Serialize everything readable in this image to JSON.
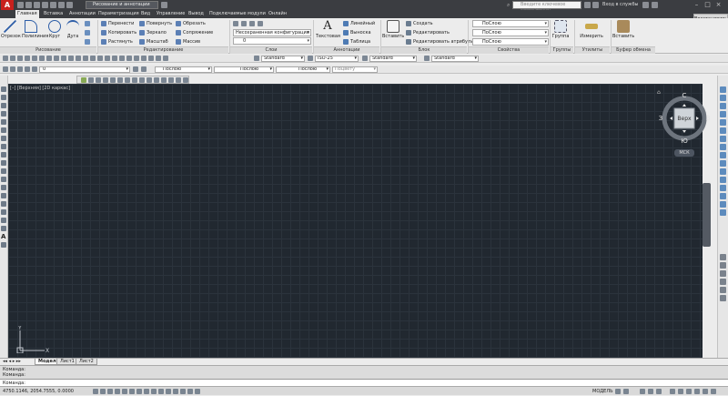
{
  "app": {
    "logo": "A",
    "window_title": ""
  },
  "workspace": "Рисование и аннотации",
  "search": {
    "placeholder": "Введите ключевое слово/фразу"
  },
  "signin": "Вход в службы",
  "tabs": [
    "Главная",
    "Вставка",
    "Аннотации",
    "Параметризация",
    "Вид",
    "Управление",
    "Вывод",
    "Подключаемые модули",
    "Онлайн"
  ],
  "restore_label": "Восстановить",
  "ribbon": {
    "draw": {
      "line": "Отрезок",
      "polyline": "Полилиния",
      "circle": "Круг",
      "arc": "Дуга",
      "label": "Рисование"
    },
    "modify": {
      "move": "Перенести",
      "copy": "Копировать",
      "stretch": "Растянуть",
      "rotate": "Повернуть",
      "mirror": "Зеркало",
      "scale": "Масштаб",
      "trim": "Обрезать",
      "fillet": "Сопряжение",
      "array": "Массив",
      "label": "Редактирование"
    },
    "layers": {
      "state": "Несохраненная конфигурация сло",
      "current": "0",
      "label": "Слои"
    },
    "annotation": {
      "text": "Текстовая",
      "linear": "Линейный",
      "leader": "Выноска",
      "table": "Таблица",
      "label": "Аннотации"
    },
    "block": {
      "insert": "Вставить",
      "create": "Создать",
      "edit": "Редактировать",
      "edit_attr": "Редактировать атрибуты",
      "label": "Блок"
    },
    "properties": {
      "color": "ПоСлою",
      "linetype": "ПоСлою",
      "lineweight": "ПоСлою",
      "label": "Свойства"
    },
    "groups": {
      "group": "Группа",
      "label": "Группы"
    },
    "utilities": {
      "measure": "Измерить",
      "label": "Утилиты"
    },
    "clipboard": {
      "paste": "Вставить",
      "label": "Буфер обмена"
    }
  },
  "toolbar1": {
    "text_style": "Standard",
    "dim_style": "ISO-25",
    "table_style": "Standard",
    "mleader_style": "Standard"
  },
  "toolbar2": {
    "layer": "0",
    "color": "Послою",
    "linetype": "Послою",
    "lineweight": "Послою",
    "plot_style": "Поцвету"
  },
  "viewport_label": "[–] [Верхняя] [2D каркас]",
  "viewcube": {
    "north": "С",
    "south": "Ю",
    "west": "З",
    "east": "В",
    "face": "Верх",
    "wcs": "МСК"
  },
  "ucs": {
    "y": "Y",
    "x": "X"
  },
  "layout_tabs": [
    "Модель",
    "Лист1",
    "Лист2"
  ],
  "command": {
    "lines": [
      "Команда:",
      "Команда:"
    ],
    "prompt": "Команда:"
  },
  "status": {
    "coords": "4750.1146, 2054.7555, 0.0000",
    "model": "МОДЕЛЬ"
  }
}
